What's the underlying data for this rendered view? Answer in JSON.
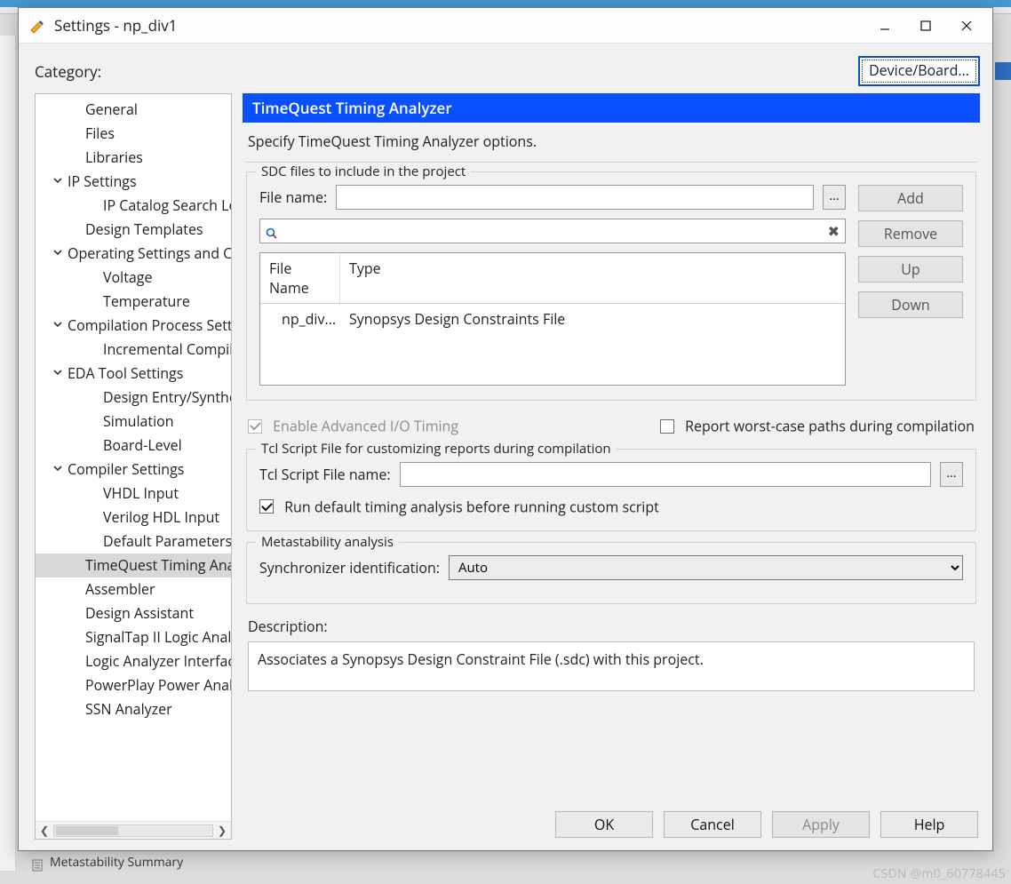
{
  "window": {
    "title": "Settings - np_div1"
  },
  "toprow": {
    "category_label": "Category:",
    "device_board_button": "Device/Board..."
  },
  "tree": {
    "items": [
      {
        "label": "General",
        "level": "l1"
      },
      {
        "label": "Files",
        "level": "l1"
      },
      {
        "label": "Libraries",
        "level": "l1"
      },
      {
        "label": "IP Settings",
        "level": "group",
        "expand": true
      },
      {
        "label": "IP Catalog Search Locations",
        "level": "l2"
      },
      {
        "label": "Design Templates",
        "level": "l1"
      },
      {
        "label": "Operating Settings and Conditions",
        "level": "group",
        "expand": true
      },
      {
        "label": "Voltage",
        "level": "l2"
      },
      {
        "label": "Temperature",
        "level": "l2"
      },
      {
        "label": "Compilation Process Settings",
        "level": "group",
        "expand": true
      },
      {
        "label": "Incremental Compilation",
        "level": "l2"
      },
      {
        "label": "EDA Tool Settings",
        "level": "group",
        "expand": true
      },
      {
        "label": "Design Entry/Synthesis",
        "level": "l2"
      },
      {
        "label": "Simulation",
        "level": "l2"
      },
      {
        "label": "Board-Level",
        "level": "l2"
      },
      {
        "label": "Compiler Settings",
        "level": "group",
        "expand": true
      },
      {
        "label": "VHDL Input",
        "level": "l2"
      },
      {
        "label": "Verilog HDL Input",
        "level": "l2"
      },
      {
        "label": "Default Parameters",
        "level": "l2"
      },
      {
        "label": "TimeQuest Timing Analyzer",
        "level": "l1",
        "selected": true
      },
      {
        "label": "Assembler",
        "level": "l1"
      },
      {
        "label": "Design Assistant",
        "level": "l1"
      },
      {
        "label": "SignalTap II Logic Analyzer",
        "level": "l1"
      },
      {
        "label": "Logic Analyzer Interface",
        "level": "l1"
      },
      {
        "label": "PowerPlay Power Analyzer",
        "level": "l1"
      },
      {
        "label": "SSN Analyzer",
        "level": "l1"
      }
    ]
  },
  "panel": {
    "title": "TimeQuest Timing Analyzer",
    "subtitle": "Specify TimeQuest Timing Analyzer options.",
    "sdc": {
      "legend": "SDC files to include in the project",
      "file_name_label": "File name:",
      "file_name_value": "",
      "browse": "...",
      "filter_value": "",
      "table": {
        "cols": [
          "File Name",
          "Type"
        ],
        "rows": [
          {
            "file": "np_div...",
            "type": "Synopsys Design Constraints File"
          }
        ]
      },
      "buttons": {
        "add": "Add",
        "remove": "Remove",
        "up": "Up",
        "down": "Down"
      }
    },
    "enable_adv_io": {
      "label": "Enable Advanced I/O Timing",
      "checked": true,
      "disabled": true
    },
    "report_worst": {
      "label": "Report worst-case paths during compilation",
      "checked": false
    },
    "tcl": {
      "legend": "Tcl Script File for customizing reports during compilation",
      "name_label": "Tcl Script File name:",
      "value": "",
      "browse": "...",
      "run_default": {
        "label": "Run default timing analysis before running custom script",
        "checked": true
      }
    },
    "meta": {
      "legend": "Metastability analysis",
      "sync_label": "Synchronizer identification:",
      "sync_value": "Auto"
    },
    "description_label": "Description:",
    "description_text": "Associates a Synopsys Design Constraint File (.sdc) with this project."
  },
  "dialog_buttons": {
    "ok": "OK",
    "cancel": "Cancel",
    "apply": "Apply",
    "help": "Help"
  },
  "background": {
    "tree_item": "Metastability Summary"
  },
  "watermark": "CSDN @m0_60778445"
}
